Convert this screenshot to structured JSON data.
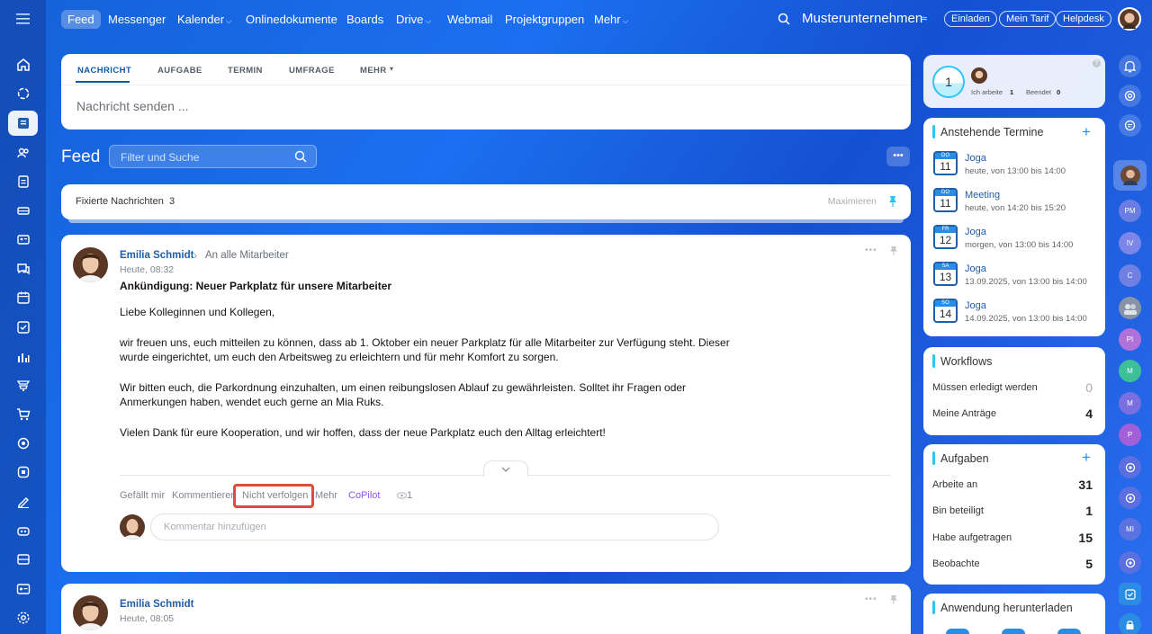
{
  "topbar": {
    "nav": [
      {
        "label": "Feed",
        "chevron": false
      },
      {
        "label": "Messenger",
        "chevron": false
      },
      {
        "label": "Kalender",
        "chevron": true
      },
      {
        "label": "Onlinedokumente",
        "chevron": false
      },
      {
        "label": "Boards",
        "chevron": false
      },
      {
        "label": "Drive",
        "chevron": true
      },
      {
        "label": "Webmail",
        "chevron": false
      },
      {
        "label": "Projektgruppen",
        "chevron": false
      },
      {
        "label": "Mehr",
        "chevron": true
      }
    ],
    "company": "Musterunternehmen",
    "buttons": {
      "invite": "Einladen",
      "plan": "Mein Tarif",
      "help": "Helpdesk"
    }
  },
  "composer": {
    "tabs": [
      "NACHRICHT",
      "AUFGABE",
      "TERMIN",
      "UMFRAGE",
      "MEHR"
    ],
    "placeholder": "Nachricht senden ..."
  },
  "feed": {
    "title": "Feed",
    "search_placeholder": "Filter und Suche",
    "more_button": "•••",
    "pinned": {
      "label": "Fixierte Nachrichten",
      "count": "3",
      "maximize": "Maximieren"
    }
  },
  "post1": {
    "author": "Emilia Schmidt",
    "audience": "An alle Mitarbeiter",
    "time": "Heute, 08:32",
    "title": "Ankündigung: Neuer Parkplatz für unsere Mitarbeiter",
    "p1": "Liebe Kolleginnen und Kollegen,",
    "p2a": "wir freuen uns, euch mitteilen zu können, dass ab 1. Oktober ein neuer Parkplatz für alle Mitarbeiter zur Verfügung steht. Dieser",
    "p2b": "wurde eingerichtet, um euch den Arbeitsweg zu erleichtern und für mehr Komfort zu sorgen.",
    "p3a": "Wir bitten euch, die Parkordnung einzuhalten, um einen reibungslosen Ablauf zu gewährleisten. Solltet ihr Fragen oder",
    "p3b": "Anmerkungen haben, wendet euch gerne an Mia Ruks.",
    "p4": "Vielen Dank für eure Kooperation, und wir hoffen, dass der neue Parkplatz euch den Alltag erleichtert!",
    "actions": {
      "like": "Gefällt mir",
      "comment": "Kommentieren",
      "unfollow": "Nicht verfolgen",
      "more": "Mehr",
      "copilot": "CoPilot",
      "views": "1"
    },
    "comment_placeholder": "Kommentar hinzufügen"
  },
  "post2": {
    "author": "Emilia Schmidt",
    "time": "Heute, 08:05"
  },
  "timeman": {
    "counter": "1",
    "working_label": "Ich arbeite",
    "working_count": "1",
    "done_label": "Beendet",
    "done_count": "0"
  },
  "events": {
    "title": "Anstehende Termine",
    "items": [
      {
        "dow": "DO",
        "day": "11",
        "title": "Joga",
        "time": "heute, von 13:00 bis 14:00"
      },
      {
        "dow": "DO",
        "day": "11",
        "title": "Meeting",
        "time": "heute, von 14:20 bis 15:20"
      },
      {
        "dow": "FR",
        "day": "12",
        "title": "Joga",
        "time": "morgen, von 13:00 bis 14:00"
      },
      {
        "dow": "SA",
        "day": "13",
        "title": "Joga",
        "time": "13.09.2025, von 13:00 bis 14:00"
      },
      {
        "dow": "SO",
        "day": "14",
        "title": "Joga",
        "time": "14.09.2025, von 13:00 bis 14:00"
      }
    ]
  },
  "workflows": {
    "title": "Workflows",
    "rows": [
      {
        "label": "Müssen erledigt werden",
        "value": "0"
      },
      {
        "label": "Meine Anträge",
        "value": "4"
      }
    ]
  },
  "tasks": {
    "title": "Aufgaben",
    "rows": [
      {
        "label": "Arbeite an",
        "value": "31"
      },
      {
        "label": "Bin beteiligt",
        "value": "1"
      },
      {
        "label": "Habe aufgetragen",
        "value": "15"
      },
      {
        "label": "Beobachte",
        "value": "5"
      }
    ]
  },
  "app_download": {
    "title": "Anwendung herunterladen"
  },
  "rightbar": {
    "avatars": [
      {
        "initials": "PM",
        "color": "#6b7de0"
      },
      {
        "initials": "IV",
        "color": "#7b86e8"
      },
      {
        "initials": "C",
        "color": "#6f7fe2"
      },
      {
        "initials": "PI",
        "color": "#b072d8"
      },
      {
        "initials": "M",
        "color": "#3dbf9a"
      },
      {
        "initials": "M",
        "color": "#7a6fe0"
      },
      {
        "initials": "P",
        "color": "#a35fd8"
      },
      {
        "initials": "MI",
        "color": "#5b73e0"
      }
    ]
  },
  "colors": {
    "accent": "#1f5ea8",
    "highlight": "#e04b3a",
    "copilot": "#8e52ec"
  }
}
